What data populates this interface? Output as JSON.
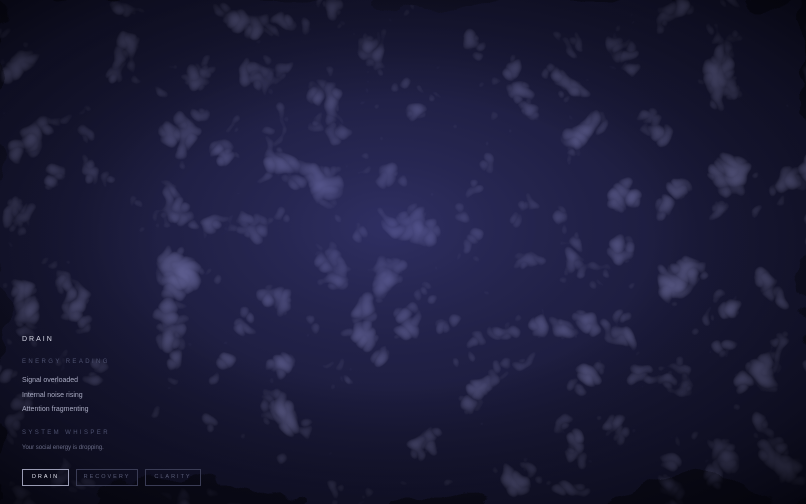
{
  "mode": {
    "title": "DRAIN"
  },
  "energy": {
    "label": "ENERGY READING",
    "items": [
      "Signal overloaded",
      "Internal noise rising",
      "Attention fragmenting"
    ]
  },
  "system": {
    "label": "SYSTEM WHISPER",
    "message": "Your social energy is dropping."
  },
  "controls": {
    "buttons": [
      {
        "label": "DRAIN",
        "active": true
      },
      {
        "label": "RECOVERY",
        "active": false
      },
      {
        "label": "CLARITY",
        "active": false
      }
    ]
  },
  "colors": {
    "background_base": "#0c0c1a",
    "fluid_highlight": "#3a3a78",
    "text_primary": "#d7d8e6",
    "text_muted": "#4e5270"
  }
}
